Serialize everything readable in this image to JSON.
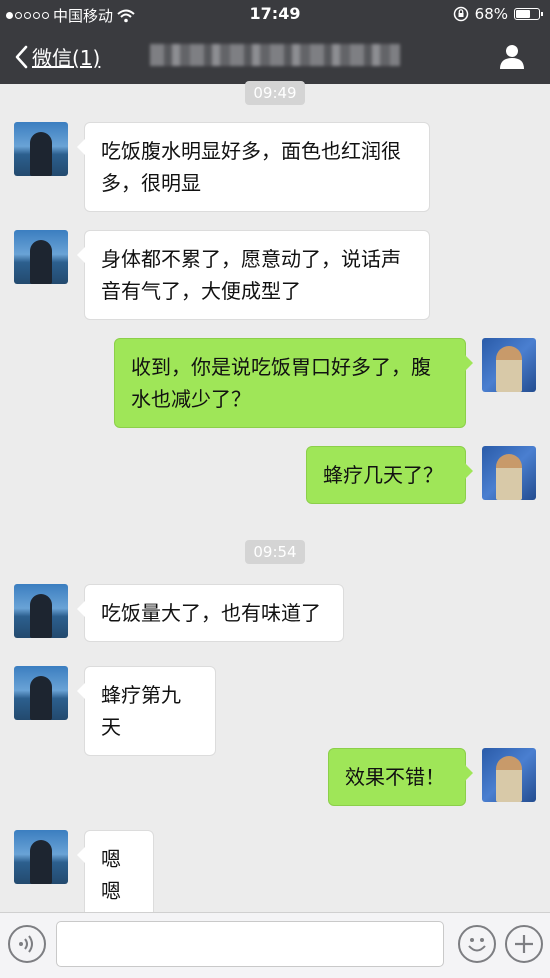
{
  "status_bar": {
    "carrier": "中国移动",
    "time": "17:49",
    "battery": "68%",
    "battery_level": 0.68
  },
  "nav": {
    "back_label": "微信(1)"
  },
  "timestamps": [
    "09:49",
    "09:54"
  ],
  "messages": [
    {
      "side": "in",
      "text": "吃饭腹水明显好多，面色也红润很多，很明显"
    },
    {
      "side": "in",
      "text": "身体都不累了，愿意动了，说话声音有气了，大便成型了"
    },
    {
      "side": "out",
      "text": "收到，你是说吃饭胃口好多了，腹水也减少了？"
    },
    {
      "side": "out",
      "text": "蜂疗几天了？"
    },
    {
      "side": "in",
      "text": "吃饭量大了，也有味道了"
    },
    {
      "side": "in",
      "text": "蜂疗第九天"
    },
    {
      "side": "out",
      "text": "效果不错！"
    },
    {
      "side": "in",
      "text": "嗯嗯"
    }
  ],
  "colors": {
    "bar": "#3a3b3f",
    "background": "#ececec",
    "out_bubble": "#9fe658",
    "in_bubble": "#ffffff"
  },
  "icons": {
    "back": "chevron-left-icon",
    "profile": "person-icon",
    "voice": "voice-icon",
    "emoji": "emoji-icon",
    "plus": "plus-icon",
    "wifi": "wifi-icon",
    "lock": "rotation-lock-icon",
    "battery": "battery-icon"
  }
}
